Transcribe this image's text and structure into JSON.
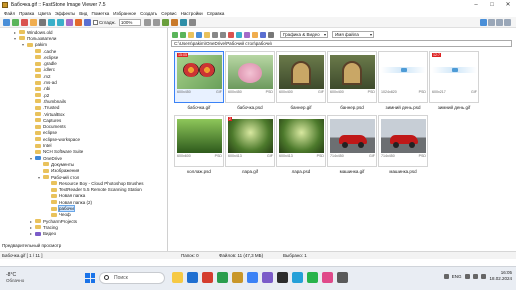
{
  "window": {
    "title": "Бабочка.gif :: FastStone Image Viewer 7.5",
    "controls": [
      "–",
      "□",
      "✕"
    ]
  },
  "menu": [
    "Файл",
    "Правка",
    "Цвета",
    "Эффекты",
    "Вид",
    "Пометка",
    "Избранное",
    "Создать",
    "Сервис",
    "Настройки",
    "Справка"
  ],
  "toolbar": {
    "fit_label": "Сгладж.",
    "zoom_value": "100%"
  },
  "tree": [
    {
      "label": "Windows.old",
      "depth": 1,
      "expanded": false
    },
    {
      "label": "Пользователи",
      "depth": 1,
      "expanded": true
    },
    {
      "label": "pakim",
      "depth": 2,
      "expanded": true
    },
    {
      "label": ".cache",
      "depth": 3
    },
    {
      "label": ".eclipse",
      "depth": 3
    },
    {
      "label": ".gradle",
      "depth": 3
    },
    {
      "label": ".idlerc",
      "depth": 3
    },
    {
      "label": ".m2",
      "depth": 3
    },
    {
      "label": ".ms-ad",
      "depth": 3
    },
    {
      "label": ".nbi",
      "depth": 3
    },
    {
      "label": ".p2",
      "depth": 3
    },
    {
      "label": ".thumbnails",
      "depth": 3
    },
    {
      "label": ".Trusted",
      "depth": 3
    },
    {
      "label": ".VirtualBox",
      "depth": 3
    },
    {
      "label": "Captures",
      "depth": 3
    },
    {
      "label": "Documents",
      "depth": 3
    },
    {
      "label": "eclipse",
      "depth": 3
    },
    {
      "label": "eclipse-workspace",
      "depth": 3
    },
    {
      "label": "Intel",
      "depth": 3
    },
    {
      "label": "NCH Software Suite",
      "depth": 3
    },
    {
      "label": "OneDrive",
      "depth": 3,
      "expanded": true
    },
    {
      "label": "Документы",
      "depth": 4
    },
    {
      "label": "Изображения",
      "depth": 4
    },
    {
      "label": "Рабочий стол",
      "depth": 4,
      "expanded": true
    },
    {
      "label": "Resource Boy - Cloud Photoshop Brushes",
      "depth": 5
    },
    {
      "label": "TextReader 5.5 Remote Scanning Station",
      "depth": 5
    },
    {
      "label": "Новая папка",
      "depth": 5
    },
    {
      "label": "Новая папка (2)",
      "depth": 5
    },
    {
      "label": "рабочи",
      "depth": 5,
      "selected": true
    },
    {
      "label": "Чеоф",
      "depth": 5
    },
    {
      "label": "PycharmProjects",
      "depth": 3
    },
    {
      "label": "Tracing",
      "depth": 3
    },
    {
      "label": "Видео",
      "depth": 3
    }
  ],
  "nav": {
    "filter": "Графика & Видео",
    "sort": "Имя файла",
    "path": "C:\\Users\\pakim\\OneDrive\\Рабочий стол\\рабочи\\"
  },
  "thumbnails": [
    {
      "name": "бабочка.gif",
      "dims": "600x450",
      "ext": "GIF",
      "art": "butterfly",
      "selected": true,
      "badge": "15:05"
    },
    {
      "name": "бабочка.psd",
      "dims": "600x450",
      "ext": "PSD",
      "art": "flower"
    },
    {
      "name": "баннер.gif",
      "dims": "600x400",
      "ext": "GIF",
      "art": "banner"
    },
    {
      "name": "баннер.psd",
      "dims": "600x400",
      "ext": "PSD",
      "art": "banner"
    },
    {
      "name": "зимний день.psd",
      "dims": "1024x820",
      "ext": "PSD",
      "art": "winter"
    },
    {
      "name": "зимний день.gif",
      "dims": "600x217",
      "ext": "GIF",
      "art": "winter",
      "badge": "12:7"
    },
    {
      "name": "коллаж.psd",
      "dims": "600x600",
      "ext": "PSD",
      "art": "forest"
    },
    {
      "name": "лара.gif",
      "dims": "600x413",
      "ext": "GIF",
      "art": "lara",
      "badge": "2"
    },
    {
      "name": "лара.psd",
      "dims": "600x413",
      "ext": "PSD",
      "art": "lara"
    },
    {
      "name": "машинка.gif",
      "dims": "714x450",
      "ext": "GIF",
      "art": "car"
    },
    {
      "name": "машинка.psd",
      "dims": "714x450",
      "ext": "PSD",
      "art": "car"
    }
  ],
  "preview": {
    "label": "Предварительный просмотр"
  },
  "status": {
    "left": "Бабочка.gif [ 1 / 11 ]",
    "folders": "Папок: 0",
    "files": "Файлов: 11 (47,3 МБ)",
    "selected": "Выбрано: 1"
  },
  "taskbar": {
    "temperature": "-8°C",
    "weather": "Облачно",
    "search_placeholder": "Поиск",
    "language": "ENG",
    "time": "16:05",
    "date": "18.02.2024"
  },
  "colors": {
    "accent": "#3b82f6",
    "tree_selection": "#cce4ff",
    "folder": "#e9c25c"
  }
}
